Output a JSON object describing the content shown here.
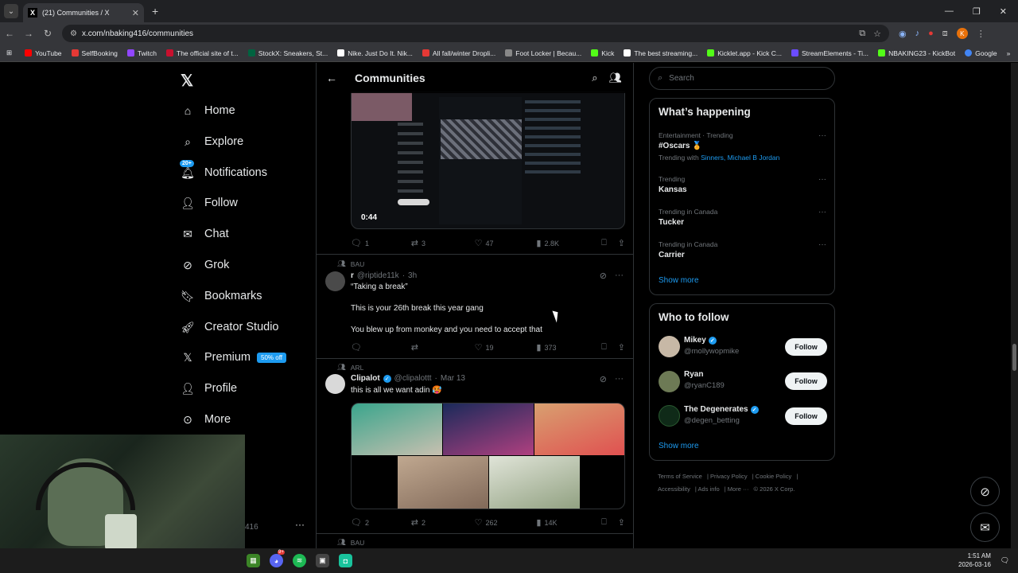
{
  "browser": {
    "tab_title": "(21) Communities / X",
    "tab_favicon": "X",
    "url": "x.com/nbaking416/communities",
    "profile_initial": "K",
    "bookmarks": [
      {
        "label": "YouTube",
        "color": "#ff0000"
      },
      {
        "label": "SelfBooking",
        "color": "#e53935"
      },
      {
        "label": "Twitch",
        "color": "#9146ff"
      },
      {
        "label": "The official site of t...",
        "color": "#c8102e"
      },
      {
        "label": "StockX: Sneakers, St...",
        "color": "#006340"
      },
      {
        "label": "Nike. Just Do It. Nik...",
        "color": "#ffffff"
      },
      {
        "label": "All fall/winter Dropli...",
        "color": "#e53935"
      },
      {
        "label": "Foot Locker | Becau...",
        "color": "#888888"
      },
      {
        "label": "Kick",
        "color": "#53fc18"
      },
      {
        "label": "The best streaming...",
        "color": "#ffffff"
      },
      {
        "label": "Kicklet.app - Kick C...",
        "color": "#53fc18"
      },
      {
        "label": "StreamElements - Ti...",
        "color": "#6b4cff"
      },
      {
        "label": "NBAKING23 - KickBot",
        "color": "#53fc18"
      },
      {
        "label": "Google",
        "color": "#4285f4"
      }
    ]
  },
  "nav": {
    "home": "Home",
    "explore": "Explore",
    "notifications": "Notifications",
    "notifications_badge": "20+",
    "follow": "Follow",
    "chat": "Chat",
    "grok": "Grok",
    "bookmarks": "Bookmarks",
    "creator_studio": "Creator Studio",
    "premium": "Premium",
    "premium_badge": "50% off",
    "profile": "Profile",
    "more": "More",
    "account_handle_fragment": "416"
  },
  "feed": {
    "title": "Communities",
    "video_post": {
      "duration": "0:44",
      "replies": "1",
      "reposts": "3",
      "likes": "47",
      "views": "2.8K"
    },
    "post1": {
      "community": "BAU",
      "name": "r",
      "handle": "@riptide11k",
      "time": "3h",
      "line1": "“Taking a break”",
      "line2": "This is your 26th break this year gang",
      "line3": "You blew up from monkey and you need to accept that",
      "replies": "",
      "reposts": "",
      "likes": "19",
      "views": "373"
    },
    "post2": {
      "community": "ARL",
      "name": "Clipalot",
      "handle": "@clipalottt",
      "time": "Mar 13",
      "text": "this is all we want adin 🥵",
      "replies": "2",
      "reposts": "2",
      "likes": "262",
      "views": "14K"
    },
    "post3_community": "BAU"
  },
  "sidebar_right": {
    "search_placeholder": "Search",
    "whats_happening_title": "What’s happening",
    "trends": [
      {
        "meta": "Entertainment · Trending",
        "name": "#Oscars 🏅",
        "with_prefix": "Trending with",
        "with_links": "Sinners, Michael B Jordan"
      },
      {
        "meta": "Trending",
        "name": "Kansas"
      },
      {
        "meta": "Trending in Canada",
        "name": "Tucker"
      },
      {
        "meta": "Trending in Canada",
        "name": "Carrier"
      }
    ],
    "show_more": "Show more",
    "who_to_follow_title": "Who to follow",
    "follow_suggestions": [
      {
        "name": "Mikey",
        "handle": "@mollywopmike",
        "verified": true
      },
      {
        "name": "Ryan",
        "handle": "@ryanC189",
        "verified": false
      },
      {
        "name": "The Degenerates",
        "handle": "@degen_betting",
        "verified": true
      }
    ],
    "follow_label": "Follow",
    "show_more_2": "Show more",
    "footer": {
      "terms": "Terms of Service",
      "privacy": "Privacy Policy",
      "cookie": "Cookie Policy",
      "accessibility": "Accessibility",
      "ads": "Ads info",
      "more": "More ···",
      "copyright": "© 2026 X Corp."
    }
  },
  "taskbar": {
    "time": "1:51 AM",
    "date": "2026-03-16",
    "discord_badge": "9+"
  }
}
